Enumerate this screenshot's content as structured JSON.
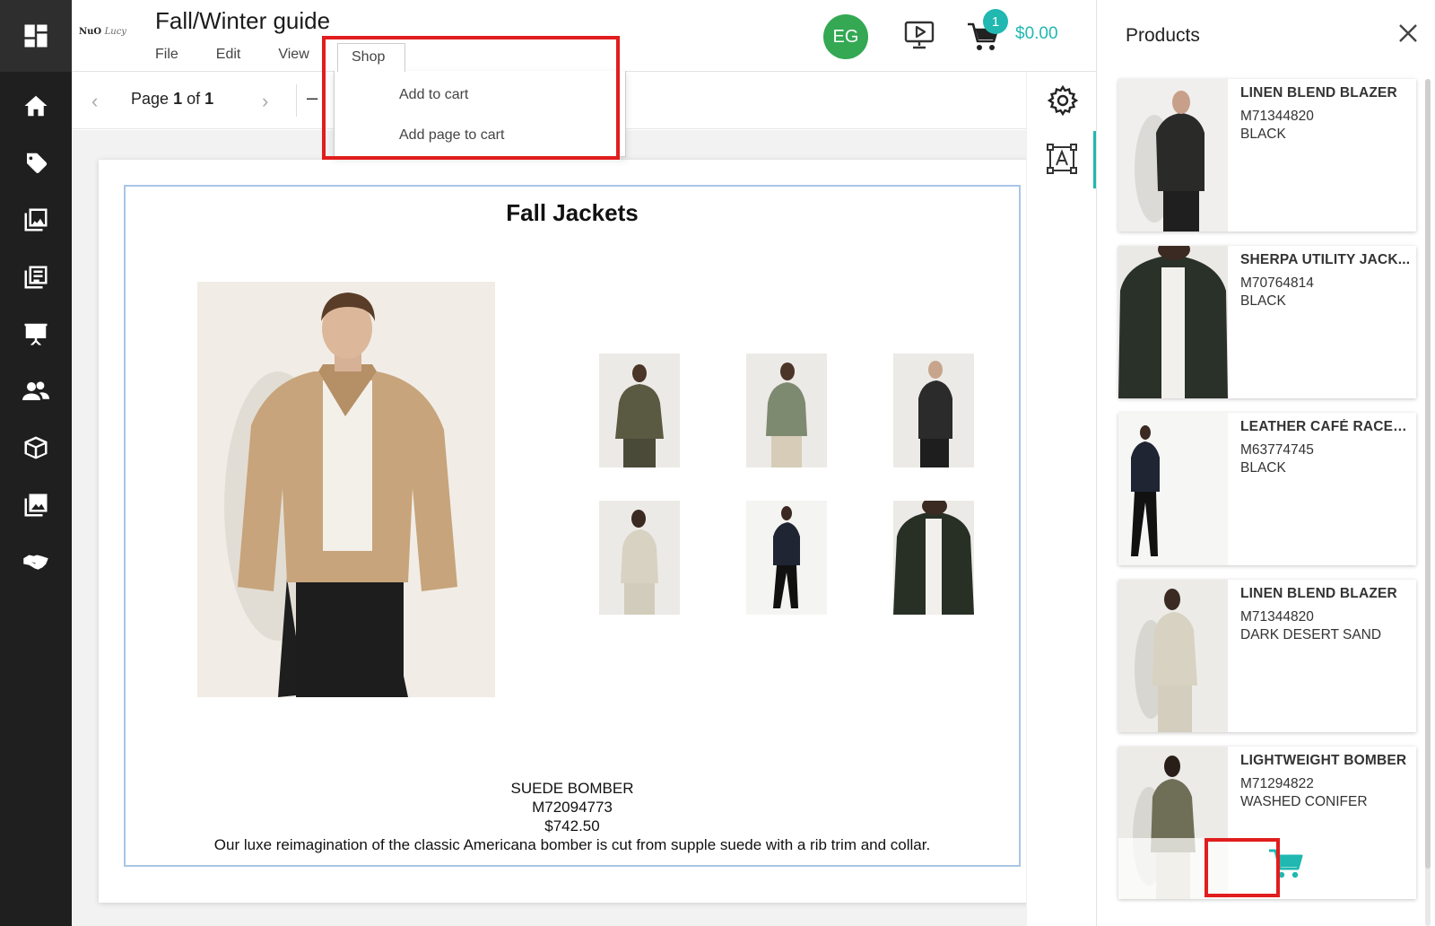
{
  "app": {
    "logo_text": "NuO",
    "logo_script": "Lucy",
    "document_title": "Fall/Winter guide",
    "user_initials": "EG",
    "cart_count": "1",
    "cart_total": "$0.00",
    "colors": {
      "accent": "#20b8b0",
      "avatar": "#34a853",
      "highlight": "#e11d1d"
    }
  },
  "menu": {
    "file": "File",
    "edit": "Edit",
    "view": "View",
    "shop": "Shop",
    "shop_items": [
      "Add to cart",
      "Add page to cart"
    ]
  },
  "toolbar": {
    "page_word": "Page",
    "page_current": "1",
    "of_word": "of",
    "page_total": "1"
  },
  "page": {
    "heading": "Fall Jackets",
    "product_name": "SUEDE BOMBER",
    "product_sku": "M72094773",
    "product_price": "$742.50",
    "product_description": "Our luxe reimagination of the classic Americana bomber is cut from supple suede with a rib trim and collar."
  },
  "panel": {
    "title": "Products",
    "products": [
      {
        "name": "LINEN BLEND BLAZER",
        "sku": "M71344820",
        "color": "BLACK"
      },
      {
        "name": "SHERPA UTILITY JACK...",
        "sku": "M70764814",
        "color": "BLACK"
      },
      {
        "name": "LEATHER CAFÉ RACE J...",
        "sku": "M63774745",
        "color": "BLACK"
      },
      {
        "name": "LINEN BLEND BLAZER",
        "sku": "M71344820",
        "color": "DARK DESERT SAND"
      },
      {
        "name": "LIGHTWEIGHT BOMBER",
        "sku": "M71294822",
        "color": "WASHED CONIFER"
      }
    ]
  }
}
